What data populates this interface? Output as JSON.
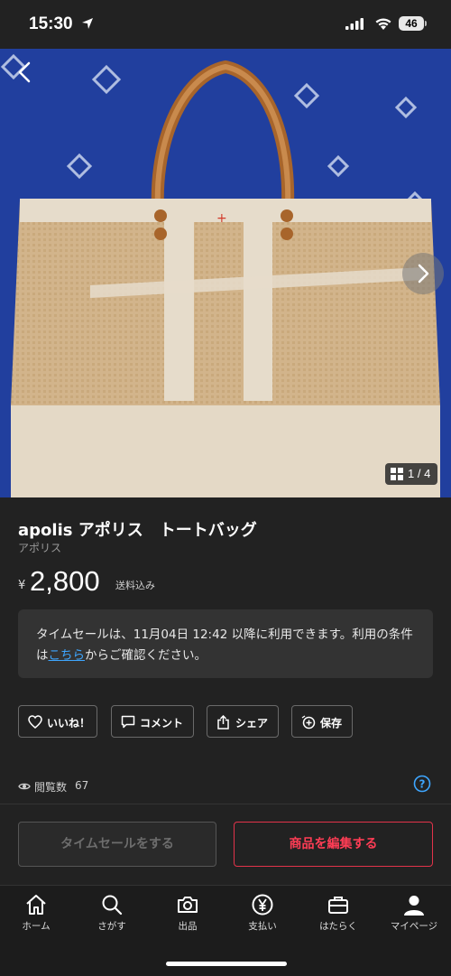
{
  "status_bar": {
    "time": "15:30",
    "battery": "46"
  },
  "gallery": {
    "counter": "1 / 4"
  },
  "product": {
    "title": "apolis アポリス　トートバッグ",
    "brand": "アポリス",
    "currency_symbol": "¥",
    "price": "2,800",
    "shipping": "送料込み"
  },
  "notice": {
    "text_before": "タイムセールは、11月04日 12:42 以降に利用できます。利用の条件は",
    "link": "こちら",
    "text_after": "からご確認ください。"
  },
  "actions": {
    "like": "いいね！",
    "comment": "コメント",
    "share": "シェア",
    "save": "保存"
  },
  "views": {
    "label": "閲覧数",
    "count": "67"
  },
  "buttons": {
    "timesale": "タイムセールをする",
    "edit": "商品を編集する"
  },
  "tabbar": {
    "items": [
      {
        "label": "ホーム",
        "icon": "home-icon"
      },
      {
        "label": "さがす",
        "icon": "search-icon"
      },
      {
        "label": "出品",
        "icon": "camera-icon"
      },
      {
        "label": "支払い",
        "icon": "yen-icon"
      },
      {
        "label": "はたらく",
        "icon": "briefcase-icon"
      },
      {
        "label": "マイページ",
        "icon": "person-icon"
      }
    ]
  },
  "colors": {
    "background": "#222222",
    "accent": "#ff3d55",
    "link": "#3ea6ff",
    "help": "#3ea6ff"
  }
}
